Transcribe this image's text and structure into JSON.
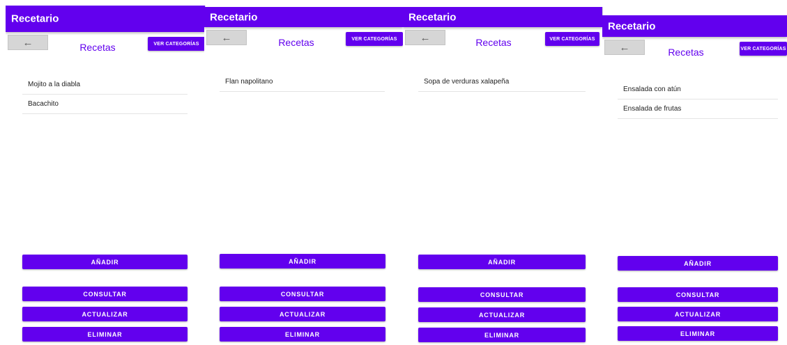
{
  "colors": {
    "primary": "#6200ee",
    "on_primary": "#ffffff",
    "back_button_bg": "#d6d6d6"
  },
  "icons": {
    "back": "arrow-left-icon"
  },
  "screens": [
    {
      "app_title": "Recetario",
      "back_glyph": "←",
      "title": "Recetas",
      "categories_button": "VER CATEGORÍAS",
      "recipes": [
        "Mojito a la diabla",
        "Bacachito"
      ],
      "buttons": {
        "add": "AÑADIR",
        "consult": "CONSULTAR",
        "update": "ACTUALIZAR",
        "delete": "ELIMINAR"
      }
    },
    {
      "app_title": "Recetario",
      "back_glyph": "←",
      "title": "Recetas",
      "categories_button": "VER CATEGORÍAS",
      "recipes": [
        "Flan napolitano"
      ],
      "buttons": {
        "add": "AÑADIR",
        "consult": "CONSULTAR",
        "update": "ACTUALIZAR",
        "delete": "ELIMINAR"
      }
    },
    {
      "app_title": "Recetario",
      "back_glyph": "←",
      "title": "Recetas",
      "categories_button": "VER CATEGORÍAS",
      "recipes": [
        "Sopa de verduras xalapeña"
      ],
      "buttons": {
        "add": "AÑADIR",
        "consult": "CONSULTAR",
        "update": "ACTUALIZAR",
        "delete": "ELIMINAR"
      }
    },
    {
      "app_title": "Recetario",
      "back_glyph": "←",
      "title": "Recetas",
      "categories_button": "VER CATEGORÍAS",
      "recipes": [
        "Ensalada con atún",
        "Ensalada de frutas"
      ],
      "buttons": {
        "add": "AÑADIR",
        "consult": "CONSULTAR",
        "update": "ACTUALIZAR",
        "delete": "ELIMINAR"
      }
    }
  ]
}
